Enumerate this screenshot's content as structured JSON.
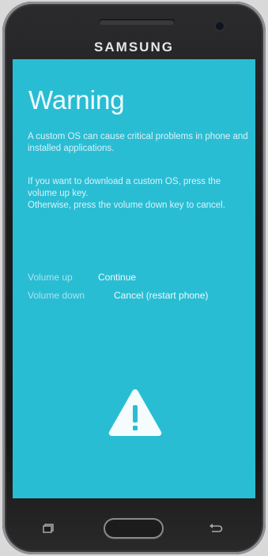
{
  "device": {
    "brand": "SAMSUNG"
  },
  "screen": {
    "title": "Warning",
    "paragraph_1": "A custom OS can cause critical problems in phone and installed applications.",
    "paragraph_2_line_1": "If you want to download a custom OS, press the volume up key.",
    "paragraph_2_line_2": "Otherwise, press the volume down key to cancel.",
    "options": [
      {
        "key": "Volume up",
        "action": "Continue"
      },
      {
        "key": "Volume down",
        "action": "Cancel (restart phone)"
      }
    ]
  },
  "icons": {
    "warning": "warning-triangle-icon",
    "recent": "recent-apps-icon",
    "back": "back-arrow-icon"
  },
  "colors": {
    "screen_background": "#29bdd4",
    "text": "#eaf9fc"
  }
}
